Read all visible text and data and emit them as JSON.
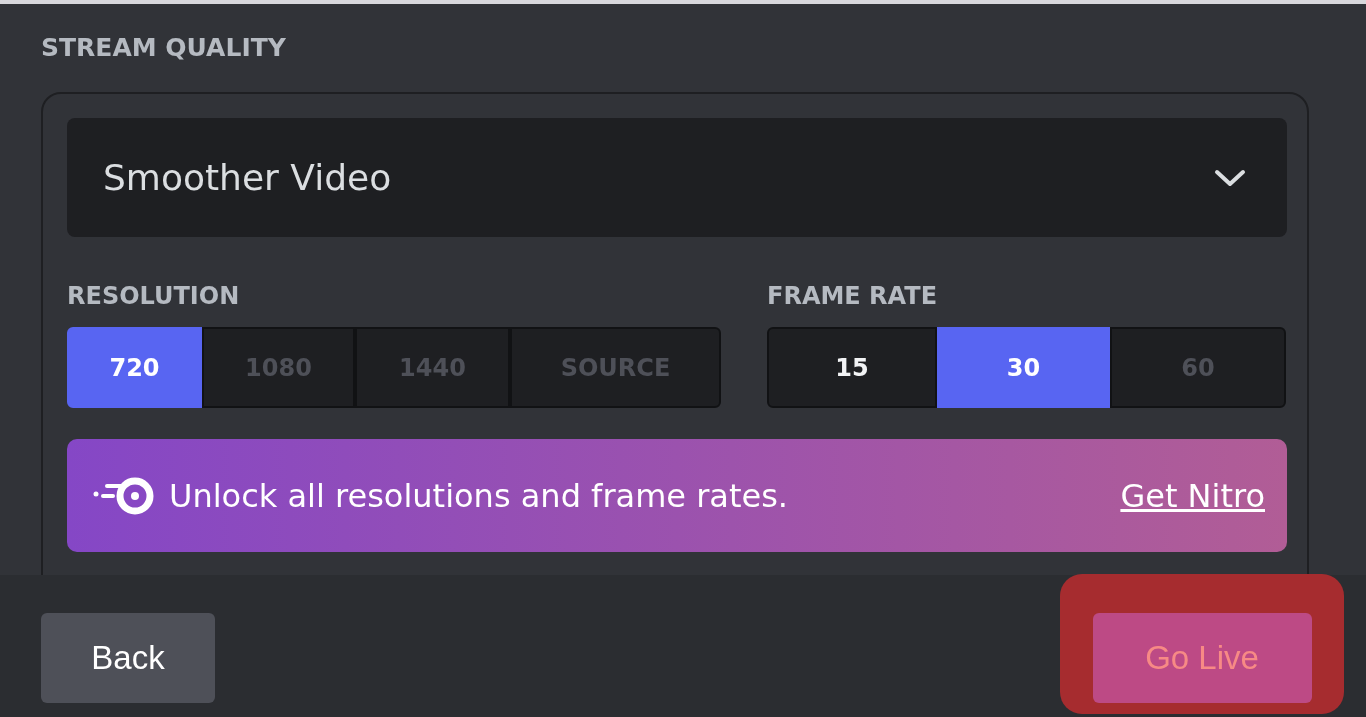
{
  "section_title": "STREAM QUALITY",
  "preset": {
    "value": "Smoother Video"
  },
  "groups": [
    {
      "label": "RESOLUTION",
      "options": [
        {
          "label": "720",
          "selected": true,
          "disabled": false
        },
        {
          "label": "1080",
          "selected": false,
          "disabled": true
        },
        {
          "label": "1440",
          "selected": false,
          "disabled": true
        },
        {
          "label": "SOURCE",
          "selected": false,
          "disabled": true
        }
      ]
    },
    {
      "label": "FRAME RATE",
      "options": [
        {
          "label": "15",
          "selected": false,
          "disabled": false
        },
        {
          "label": "30",
          "selected": true,
          "disabled": false
        },
        {
          "label": "60",
          "selected": false,
          "disabled": true
        }
      ]
    }
  ],
  "upsell": {
    "text": "Unlock all resolutions and frame rates.",
    "link": "Get Nitro"
  },
  "buttons": [
    {
      "label": "Back",
      "kind": "secondary",
      "highlighted": false
    },
    {
      "label": "Go Live",
      "kind": "primary",
      "highlighted": true
    }
  ]
}
